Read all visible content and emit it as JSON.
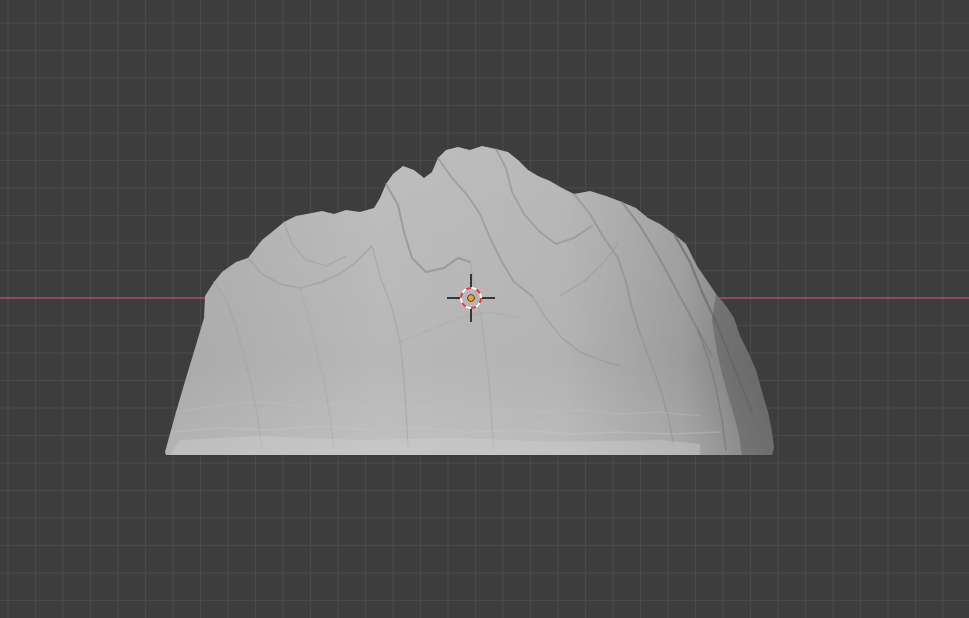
{
  "viewport": {
    "view": "front-orthographic",
    "grid_visible": true,
    "x_axis_visible": true,
    "background_color": "#3d3d3d",
    "grid_color": "#4a4a4a",
    "x_axis_color": "#a8505e"
  },
  "scene": {
    "object": {
      "kind": "terrain-mesh",
      "shading": "solid",
      "base_color": "#b5b5b5",
      "selected": false
    },
    "cursor_3d": {
      "visible": true,
      "ring_color_a": "#e23a3a",
      "ring_color_b": "#ffffff",
      "origin_dot_color": "#f29d2a"
    }
  }
}
